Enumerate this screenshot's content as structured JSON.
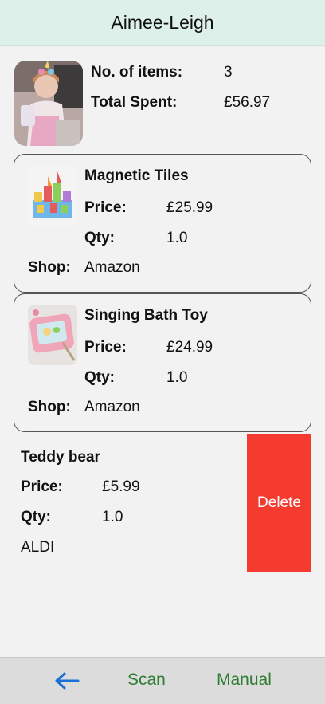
{
  "header": {
    "title": "Aimee-Leigh"
  },
  "summary": {
    "items_label": "No. of items:",
    "items_value": "3",
    "spent_label": "Total Spent:",
    "spent_value": "£56.97"
  },
  "items": [
    {
      "name": "Magnetic Tiles",
      "price_label": "Price:",
      "price": "£25.99",
      "qty_label": "Qty:",
      "qty": "1.0",
      "shop_label": "Shop:",
      "shop": "Amazon"
    },
    {
      "name": "Singing Bath Toy",
      "price_label": "Price:",
      "price": "£24.99",
      "qty_label": "Qty:",
      "qty": "1.0",
      "shop_label": "Shop:",
      "shop": "Amazon"
    },
    {
      "name": "Teddy bear",
      "price_label": "Price:",
      "price": "£5.99",
      "qty_label": "Qty:",
      "qty": "1.0",
      "shop": "ALDI"
    }
  ],
  "delete_label": "Delete",
  "footer": {
    "scan_label": "Scan",
    "manual_label": "Manual",
    "back_icon": "left-arrow-icon"
  },
  "colors": {
    "header_bg": "#ddf1ea",
    "delete_bg": "#f53b30",
    "footer_text": "#2e7d32",
    "back_arrow": "#1a6fd6"
  }
}
